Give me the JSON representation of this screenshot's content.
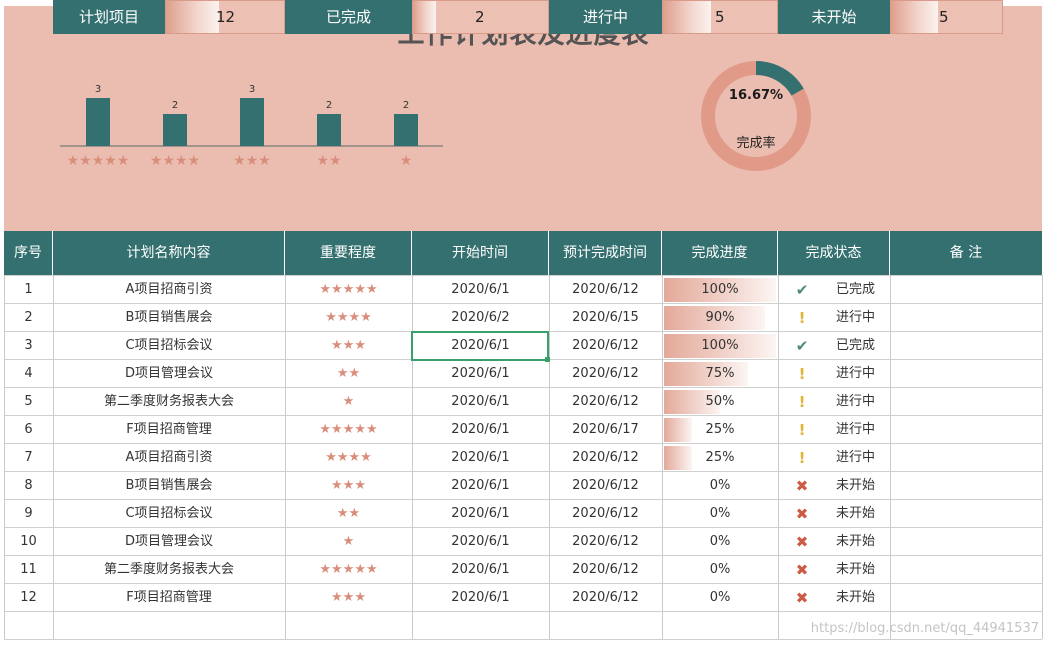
{
  "title": "工作计划表及进度表",
  "bar_chart": {
    "bars": [
      {
        "value": 3,
        "label": "3",
        "stars": "★★★★★"
      },
      {
        "value": 2,
        "label": "2",
        "stars": "★★★★"
      },
      {
        "value": 3,
        "label": "3",
        "stars": "★★★"
      },
      {
        "value": 2,
        "label": "2",
        "stars": "★★"
      },
      {
        "value": 2,
        "label": "2",
        "stars": "★"
      }
    ],
    "bar_color": "#357070",
    "star_color": "#d98e7b"
  },
  "donut": {
    "percent_text": "16.67%",
    "fraction": 0.1667,
    "label": "完成率",
    "done_color": "#357070",
    "rest_color": "#e09a87"
  },
  "summary": [
    {
      "label": "计划项目",
      "value": "12",
      "fill": 0.45
    },
    {
      "label": "已完成",
      "value": "2",
      "fill": 0.17
    },
    {
      "label": "进行中",
      "value": "5",
      "fill": 0.42
    },
    {
      "label": "未开始",
      "value": "5",
      "fill": 0.42
    }
  ],
  "table": {
    "headers": [
      "序号",
      "计划名称内容",
      "重要程度",
      "开始时间",
      "预计完成时间",
      "完成进度",
      "完成状态",
      "备 注"
    ],
    "rows": [
      {
        "no": "1",
        "name": "A项目招商引资",
        "stars": "★★★★★",
        "start": "2020/6/1",
        "end": "2020/6/12",
        "progress": "100%",
        "pct": 1.0,
        "status": "已完成",
        "icon": "check-icon"
      },
      {
        "no": "2",
        "name": "B项目销售展会",
        "stars": "★★★★",
        "start": "2020/6/2",
        "end": "2020/6/15",
        "progress": "90%",
        "pct": 0.9,
        "status": "进行中",
        "icon": "warning-icon"
      },
      {
        "no": "3",
        "name": "C项目招标会议",
        "stars": "★★★",
        "start": "2020/6/1",
        "end": "2020/6/12",
        "progress": "100%",
        "pct": 1.0,
        "status": "已完成",
        "icon": "check-icon"
      },
      {
        "no": "4",
        "name": "D项目管理会议",
        "stars": "★★",
        "start": "2020/6/1",
        "end": "2020/6/12",
        "progress": "75%",
        "pct": 0.75,
        "status": "进行中",
        "icon": "warning-icon"
      },
      {
        "no": "5",
        "name": "第二季度财务报表大会",
        "stars": "★",
        "start": "2020/6/1",
        "end": "2020/6/12",
        "progress": "50%",
        "pct": 0.5,
        "status": "进行中",
        "icon": "warning-icon"
      },
      {
        "no": "6",
        "name": "F项目招商管理",
        "stars": "★★★★★",
        "start": "2020/6/1",
        "end": "2020/6/17",
        "progress": "25%",
        "pct": 0.25,
        "status": "进行中",
        "icon": "warning-icon"
      },
      {
        "no": "7",
        "name": "A项目招商引资",
        "stars": "★★★★",
        "start": "2020/6/1",
        "end": "2020/6/12",
        "progress": "25%",
        "pct": 0.25,
        "status": "进行中",
        "icon": "warning-icon"
      },
      {
        "no": "8",
        "name": "B项目销售展会",
        "stars": "★★★",
        "start": "2020/6/1",
        "end": "2020/6/12",
        "progress": "0%",
        "pct": 0,
        "status": "未开始",
        "icon": "cross-icon"
      },
      {
        "no": "9",
        "name": "C项目招标会议",
        "stars": "★★",
        "start": "2020/6/1",
        "end": "2020/6/12",
        "progress": "0%",
        "pct": 0,
        "status": "未开始",
        "icon": "cross-icon"
      },
      {
        "no": "10",
        "name": "D项目管理会议",
        "stars": "★",
        "start": "2020/6/1",
        "end": "2020/6/12",
        "progress": "0%",
        "pct": 0,
        "status": "未开始",
        "icon": "cross-icon"
      },
      {
        "no": "11",
        "name": "第二季度财务报表大会",
        "stars": "★★★★★",
        "start": "2020/6/1",
        "end": "2020/6/12",
        "progress": "0%",
        "pct": 0,
        "status": "未开始",
        "icon": "cross-icon"
      },
      {
        "no": "12",
        "name": "F项目招商管理",
        "stars": "★★★",
        "start": "2020/6/1",
        "end": "2020/6/12",
        "progress": "0%",
        "pct": 0,
        "status": "未开始",
        "icon": "cross-icon"
      }
    ]
  },
  "watermark": "https://blog.csdn.net/qq_44941537",
  "colors": {
    "header_bg": "#357070",
    "panel_bg": "#ebbdb0",
    "accent": "#d98e7b",
    "check": "#4d8b76",
    "warning": "#e2b435",
    "cross": "#cd5a45"
  }
}
